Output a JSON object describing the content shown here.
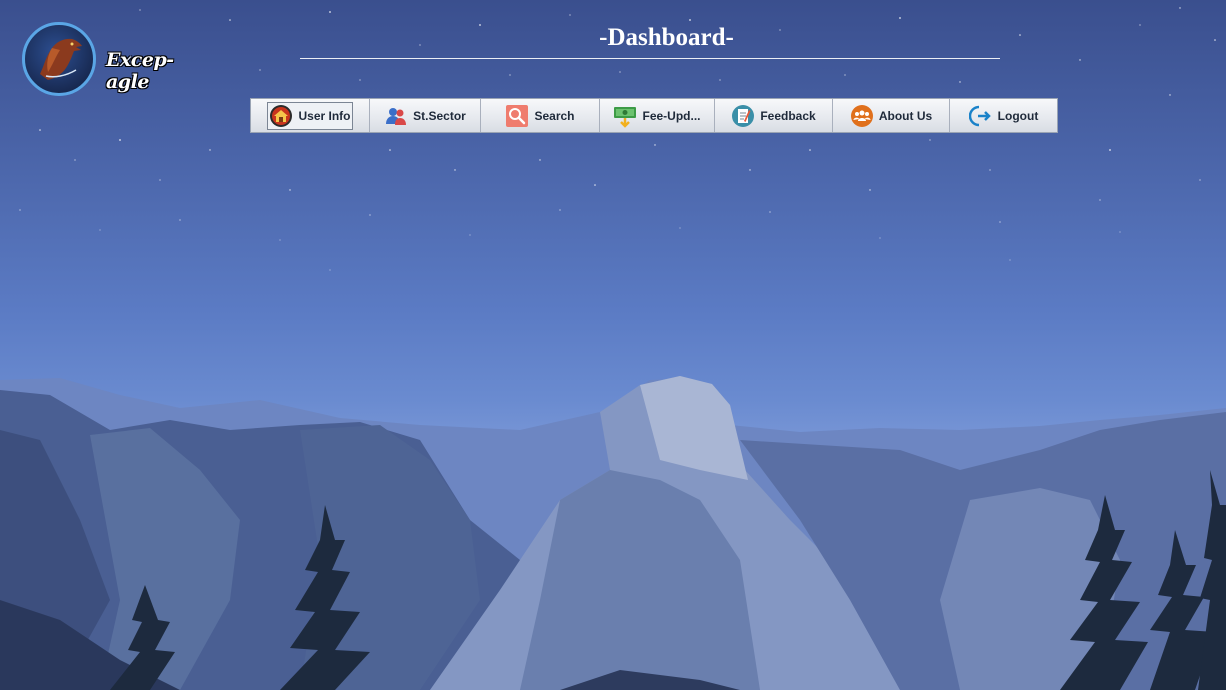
{
  "app": {
    "logo_text": "Excep-agle",
    "title": "-Dashboard-"
  },
  "toolbar": {
    "items": [
      {
        "label": "User Info",
        "icon": "home-icon",
        "active": true
      },
      {
        "label": "St.Sector",
        "icon": "users-icon"
      },
      {
        "label": "Search",
        "icon": "search-icon"
      },
      {
        "label": "Fee-Upd...",
        "icon": "money-icon"
      },
      {
        "label": "Feedback",
        "icon": "feedback-icon"
      },
      {
        "label": "About Us",
        "icon": "group-icon"
      },
      {
        "label": "Logout",
        "icon": "logout-icon"
      }
    ]
  }
}
